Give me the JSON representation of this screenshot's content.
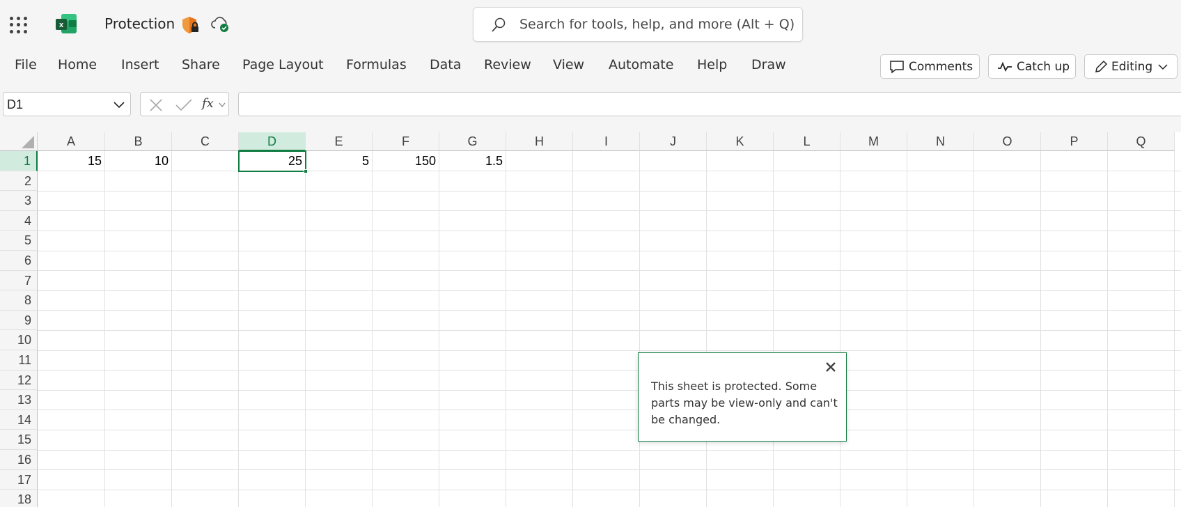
{
  "titlebar": {
    "doc_title": "Protection",
    "search_placeholder": "Search for tools, help, and more (Alt + Q)"
  },
  "menu": {
    "items": [
      "File",
      "Home",
      "Insert",
      "Share",
      "Page Layout",
      "Formulas",
      "Data",
      "Review",
      "View",
      "Automate",
      "Help",
      "Draw"
    ],
    "comments_label": "Comments",
    "catchup_label": "Catch up",
    "editing_label": "Editing"
  },
  "formula_bar": {
    "name_box": "D1",
    "fx_label": "fx",
    "formula": ""
  },
  "grid": {
    "columns": [
      "A",
      "B",
      "C",
      "D",
      "E",
      "F",
      "G",
      "H",
      "I",
      "J",
      "K",
      "L",
      "M",
      "N",
      "O",
      "P",
      "Q"
    ],
    "selected_column": "D",
    "rows": [
      "1",
      "2",
      "3",
      "4",
      "5",
      "6",
      "7",
      "8",
      "9",
      "10",
      "11",
      "12",
      "13",
      "14",
      "15",
      "16",
      "17",
      "18"
    ],
    "selected_row": "1",
    "row1_values": {
      "A": "15",
      "B": "10",
      "C": "",
      "D": "25",
      "E": "5",
      "F": "150",
      "G": "1.5"
    }
  },
  "popup": {
    "message": "This sheet is protected. Some parts may be view-only and can't be changed."
  },
  "colors": {
    "accent": "#107c41",
    "shield": "#e8751a"
  }
}
